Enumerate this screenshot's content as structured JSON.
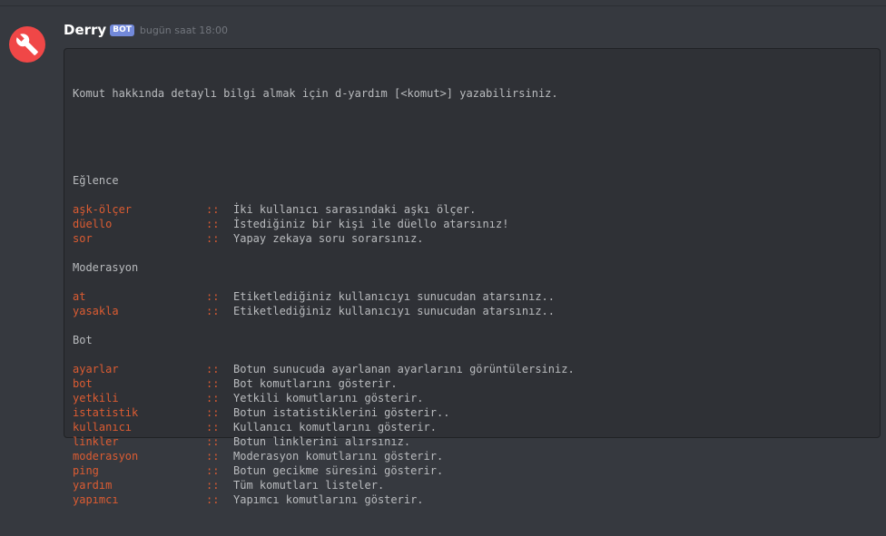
{
  "message": {
    "username": "Derry",
    "bot_tag": "BOT",
    "timestamp": "bugün saat 18:00",
    "intro": "Komut hakkında detaylı bilgi almak için d-yardım [<komut>] yazabilirsiniz.",
    "separator": "::",
    "sections": [
      {
        "title": "Eğlence",
        "commands": [
          {
            "name": "aşk-ölçer",
            "desc": "İki kullanıcı sarasındaki aşkı ölçer."
          },
          {
            "name": "düello",
            "desc": "İstediğiniz bir kişi ile düello atarsınız!"
          },
          {
            "name": "sor",
            "desc": "Yapay zekaya soru sorarsınız."
          }
        ]
      },
      {
        "title": "Moderasyon",
        "commands": [
          {
            "name": "at",
            "desc": "Etiketlediğiniz kullanıcıyı sunucudan atarsınız.."
          },
          {
            "name": "yasakla",
            "desc": "Etiketlediğiniz kullanıcıyı sunucudan atarsınız.."
          }
        ]
      },
      {
        "title": "Bot",
        "commands": [
          {
            "name": "ayarlar",
            "desc": "Botun sunucuda ayarlanan ayarlarını görüntülersiniz."
          },
          {
            "name": "bot",
            "desc": "Bot komutlarını gösterir."
          },
          {
            "name": "yetkili",
            "desc": "Yetkili komutlarını gösterir."
          },
          {
            "name": "istatistik",
            "desc": "Botun istatistiklerini gösterir.."
          },
          {
            "name": "kullanıcı",
            "desc": "Kullanıcı komutlarını gösterir."
          },
          {
            "name": "linkler",
            "desc": "Botun linklerini alırsınız."
          },
          {
            "name": "moderasyon",
            "desc": "Moderasyon komutlarını gösterir."
          },
          {
            "name": "ping",
            "desc": "Botun gecikme süresini gösterir."
          },
          {
            "name": "yardım",
            "desc": "Tüm komutları listeler."
          },
          {
            "name": "yapımcı",
            "desc": "Yapımcı komutlarını gösterir."
          }
        ]
      }
    ]
  },
  "colors": {
    "background": "#36393f",
    "codeblock": "#2f3136",
    "command": "#dc5c32",
    "text": "#b9bbbe",
    "bot_tag": "#7289da",
    "avatar": "#f04747"
  },
  "icons": {
    "avatar": "wrench-icon"
  }
}
